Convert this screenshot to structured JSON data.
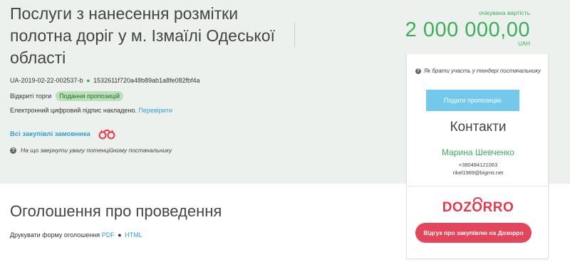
{
  "tender": {
    "title": "Послуги з нанесення розмітки полотна доріг у м. Ізмаїлі Одеської області",
    "id": "UA-2019-02-22-002537-b",
    "id_separator": "●",
    "hash": "1532611f720a48b89ab1a8fe082fbf4a",
    "procedure": "Відкриті торги",
    "status": "Подання пропозицій",
    "signature_text": "Електронний цифровий підпис накладено.",
    "signature_link": "Перевірити",
    "all_purchases_link": "Всі закупівлі замовника",
    "attention_text": "На що звернути увагу потенційному постачальнику"
  },
  "price": {
    "label": "очікувана вартість",
    "amount": "2 000 000,00",
    "currency": "UAH"
  },
  "sidebar": {
    "how_to_text": "Як брати участь у тендері постачальнику",
    "submit_button": "Подати пропозицію",
    "contacts_title": "Контакти",
    "contact_name": "Марина Шевченко",
    "contact_phone": "+380484121063",
    "contact_email": "rikel1989@bigmir.net",
    "dozorro_logo": {
      "prefix": "DO",
      "accent": "Z",
      "o": "O",
      "suffix": "RRO"
    },
    "feedback_button": "Відгук про закупівлю на Дозорро"
  },
  "announcement": {
    "title": "Оголошення про проведення",
    "print_label": "Друкувати форму оголошення",
    "pdf_link": "PDF",
    "separator": "●",
    "html_link": "HTML"
  },
  "icons": {
    "question": "question-circle-icon",
    "binoculars": "binoculars-icon"
  },
  "colors": {
    "accent_green": "#3cae5a",
    "link_blue": "#2b9fd9",
    "submit_blue": "#74c8ec",
    "dozorro_red": "#e5384b",
    "band_bg": "#edf1ee",
    "badge_bg": "#b9e2ba"
  }
}
